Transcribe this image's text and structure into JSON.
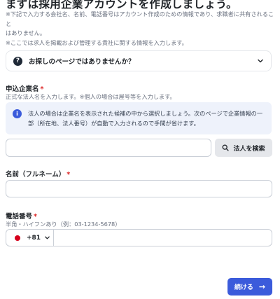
{
  "header": {
    "title": "まずは採用企業アカウントを作成しましょう。",
    "notes": [
      "※下記で入力する会社名、名前、電話番号はアカウント作成のための情報であり、求職者に共有されること",
      "はありません。",
      "※ここでは求人を掲載および管理する貴社に関する情報を入力します。"
    ]
  },
  "faq": {
    "label": "お探しのページではありませんか？",
    "icon": "question-circle-icon"
  },
  "company": {
    "label": "申込企業名",
    "required_mark": "*",
    "hint": "正式な法人名を入力します。※個人の場合は屋号等を入力します。",
    "info_lines": [
      "法人の場合は企業名を表示された候補の中から選択しましょう。次のページで企業情報の一",
      "部（所在地、法人番号）が自動で入力されるので手間が省けます。"
    ],
    "value": "",
    "search_button": "法人を検索"
  },
  "name": {
    "label": "名前（フルネーム）",
    "required_mark": "*",
    "value": ""
  },
  "phone": {
    "label": "電話番号",
    "required_mark": "*",
    "hint": "半角・ハイフンあり（例：03-1234-5678）",
    "country_code": "+81",
    "value": ""
  },
  "actions": {
    "continue_label": "続ける",
    "continue_arrow": "→"
  },
  "colors": {
    "accent": "#3b5bdb",
    "required": "#dc2626",
    "info_bg": "#eef2fb"
  }
}
